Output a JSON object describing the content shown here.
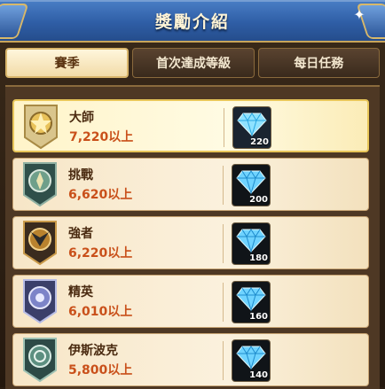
{
  "title": "獎勵介紹",
  "tabs": [
    {
      "label": "賽季",
      "active": true
    },
    {
      "label": "首次達成等級",
      "active": false
    },
    {
      "label": "每日任務",
      "active": false
    }
  ],
  "rewards": [
    {
      "rank": "大師",
      "threshold": "7,220以上",
      "badge_icon": "master-badge-icon",
      "reward_icon": "diamond-icon",
      "quantity": "220",
      "highlight": true
    },
    {
      "rank": "挑戰",
      "threshold": "6,620以上",
      "badge_icon": "challenger-badge-icon",
      "reward_icon": "diamond-icon",
      "quantity": "200",
      "highlight": false
    },
    {
      "rank": "強者",
      "threshold": "6,220以上",
      "badge_icon": "strong-badge-icon",
      "reward_icon": "diamond-icon",
      "quantity": "180",
      "highlight": false
    },
    {
      "rank": "精英",
      "threshold": "6,010以上",
      "badge_icon": "elite-badge-icon",
      "reward_icon": "diamond-icon",
      "quantity": "160",
      "highlight": false
    },
    {
      "rank": "伊斯波克",
      "threshold": "5,800以上",
      "badge_icon": "ispoke-badge-icon",
      "reward_icon": "diamond-icon",
      "quantity": "140",
      "highlight": false
    }
  ],
  "colors": {
    "title_bar": "#2f5ea6",
    "accent_gold": "#d9b56b",
    "threshold_text": "#c9501a"
  }
}
